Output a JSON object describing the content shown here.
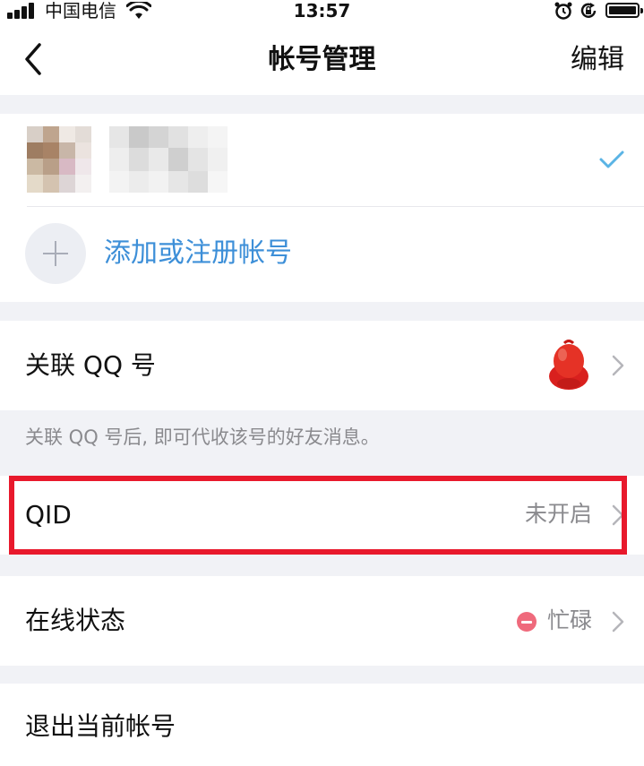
{
  "status_bar": {
    "carrier": "中国电信",
    "time": "13:57"
  },
  "nav": {
    "title": "帐号管理",
    "edit_label": "编辑"
  },
  "accounts": {
    "add_label": "添加或注册帐号"
  },
  "settings": {
    "link_qq_label": "关联 QQ 号",
    "link_qq_note": "关联 QQ 号后, 即可代收该号的好友消息。",
    "qid_label": "QID",
    "qid_value": "未开启",
    "online_status_label": "在线状态",
    "online_status_value": "忙碌",
    "logout_label": "退出当前帐号"
  },
  "colors": {
    "accent": "#3d8fd8",
    "highlight": "#e8192c",
    "busy": "#ef6a7c",
    "check": "#5ab4e5"
  },
  "icons": [
    "signal-icon",
    "wifi-icon",
    "alarm-icon",
    "rotation-lock-icon",
    "battery-icon",
    "back-icon",
    "check-icon",
    "plus-icon",
    "qq-penguin-icon",
    "chevron-right-icon",
    "busy-status-icon"
  ]
}
